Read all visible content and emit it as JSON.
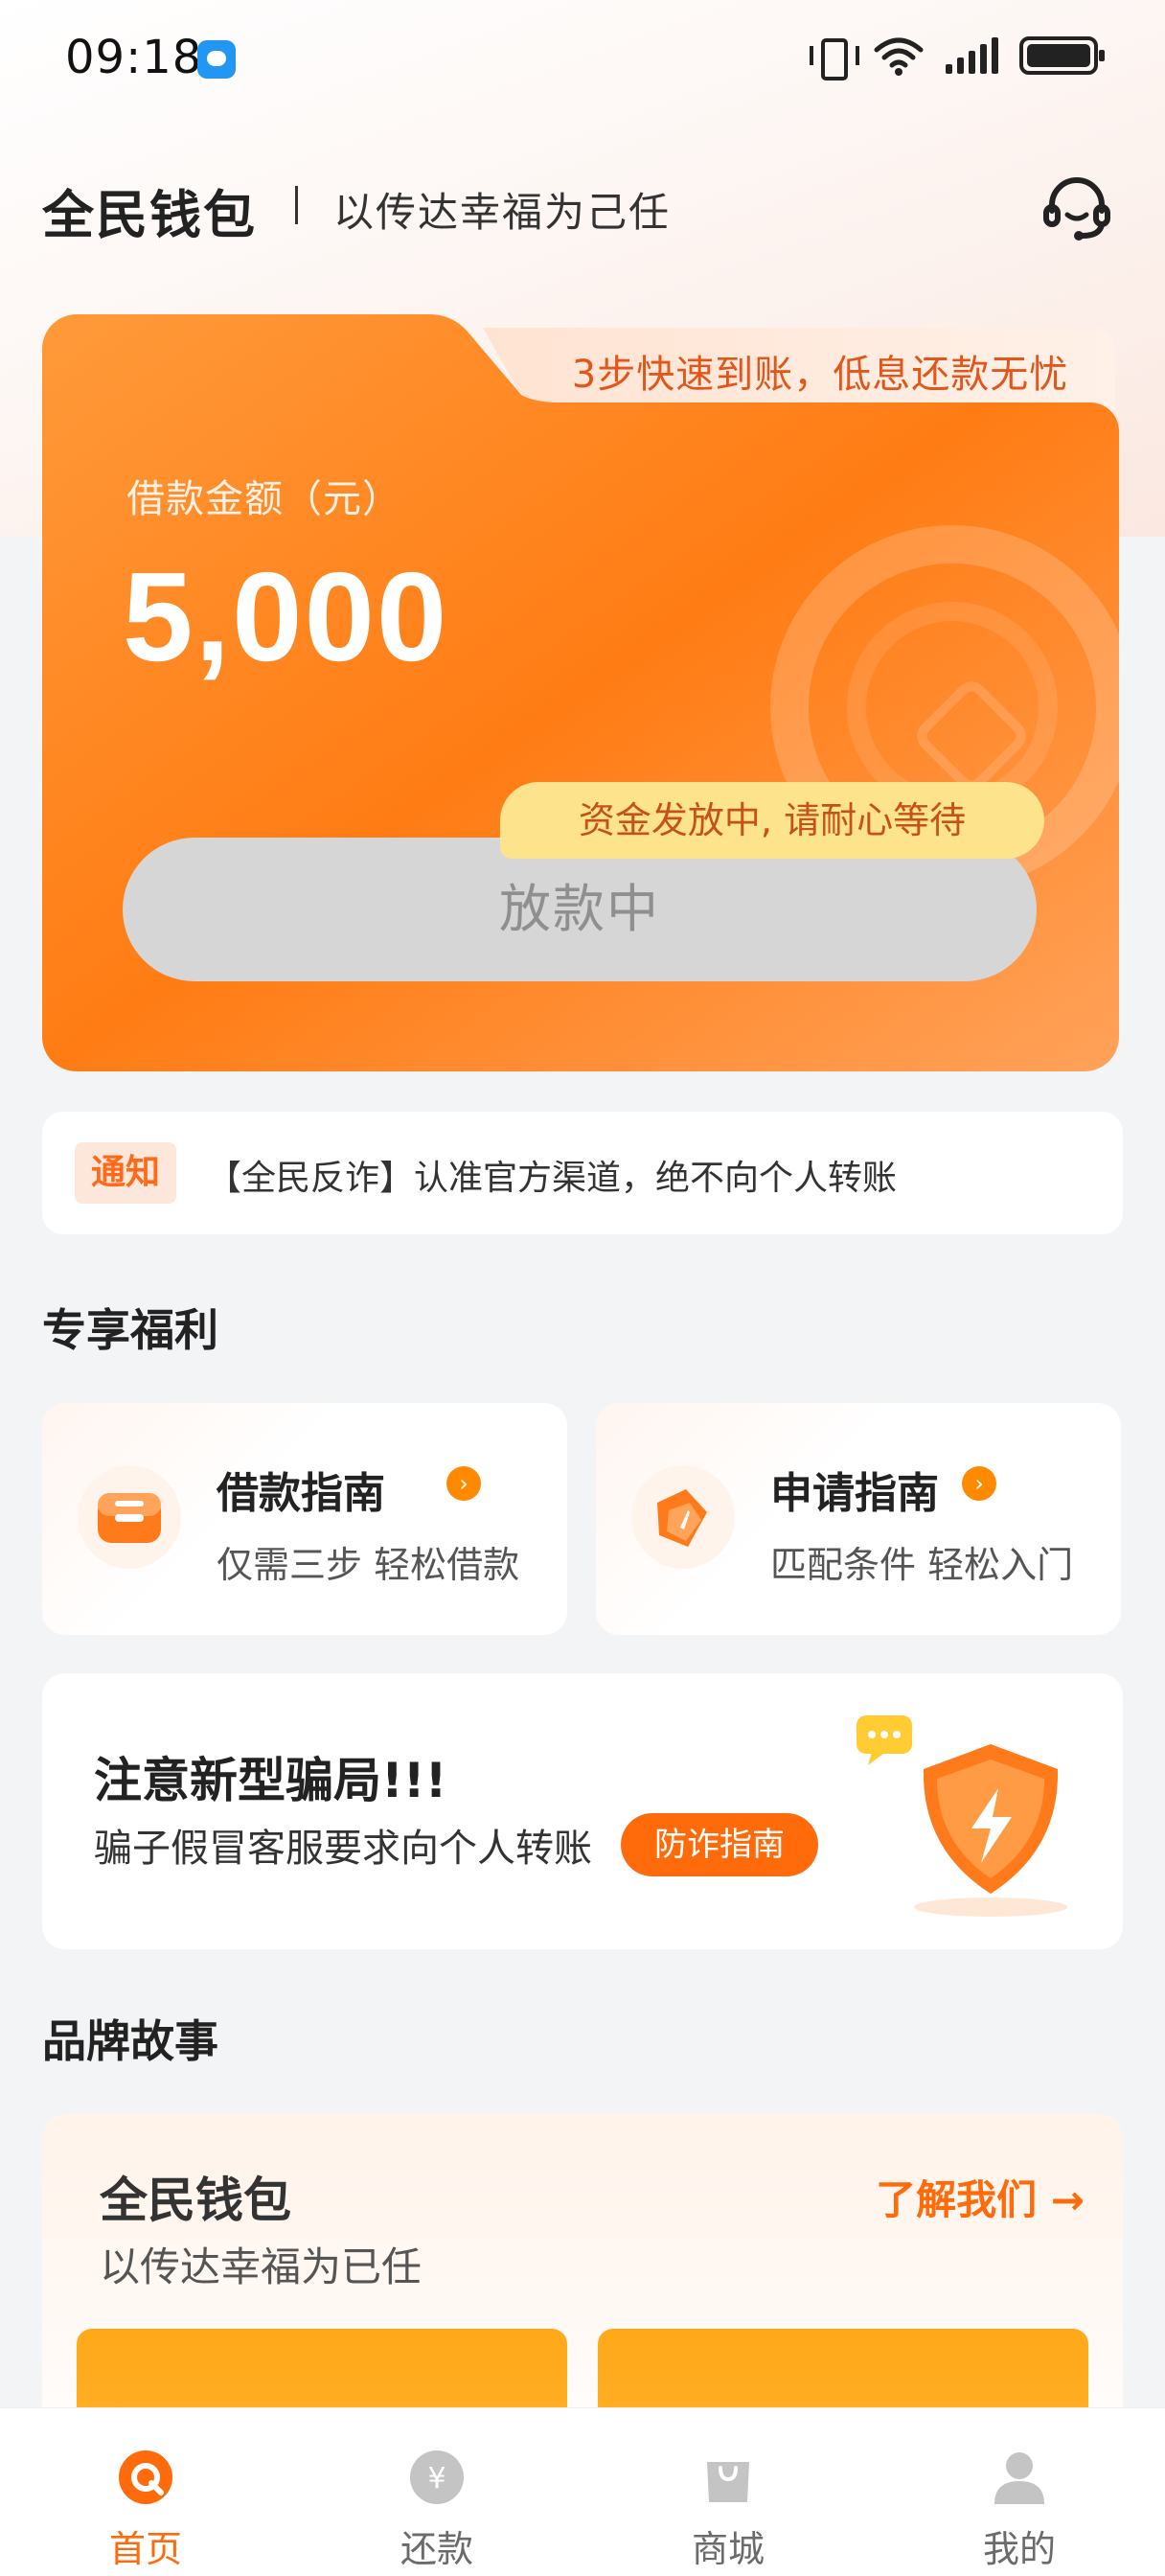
{
  "status_bar": {
    "time": "09:18",
    "icons": [
      "message-icon",
      "vibrate-icon",
      "wifi-icon",
      "signal-icon",
      "battery-icon"
    ]
  },
  "header": {
    "title": "全民钱包",
    "slogan": "以传达幸福为己任",
    "customer_service_icon": "headset-icon"
  },
  "loan_card": {
    "promo": "3步快速到账，低息还款无忧",
    "amount_label": "借款金额（元）",
    "amount": "5,000",
    "tooltip": "资金发放中, 请耐心等待",
    "status_button": "放款中",
    "colors": {
      "card": "#ff7a12",
      "pill": "#d6d6d6",
      "tooltip": "#fde38c"
    }
  },
  "notice": {
    "tag": "通知",
    "text": "【全民反诈】认准官方渠道，绝不向个人转账"
  },
  "benefits": {
    "section_title": "专享福利",
    "items": [
      {
        "title": "借款指南",
        "subtitle": "仅需三步 轻松借款",
        "icon": "wallet-icon"
      },
      {
        "title": "申请指南",
        "subtitle": "匹配条件 轻松入门",
        "icon": "compass-icon"
      }
    ]
  },
  "scam_alert": {
    "title": "注意新型骗局!!!",
    "subtitle": "骗子假冒客服要求向个人转账",
    "button": "防诈指南",
    "icon": "shield-lightning-icon"
  },
  "brand_story": {
    "section_title": "品牌故事",
    "title": "全民钱包",
    "subtitle": "以传达幸福为已任",
    "link": "了解我们 →",
    "tiles": [
      "",
      ""
    ]
  },
  "bottom_nav": {
    "items": [
      {
        "label": "首页",
        "icon": "home-icon",
        "active": true
      },
      {
        "label": "还款",
        "icon": "repay-icon",
        "active": false
      },
      {
        "label": "商城",
        "icon": "shop-icon",
        "active": false
      },
      {
        "label": "我的",
        "icon": "profile-icon",
        "active": false
      }
    ],
    "accent": "#ff6a0a"
  }
}
